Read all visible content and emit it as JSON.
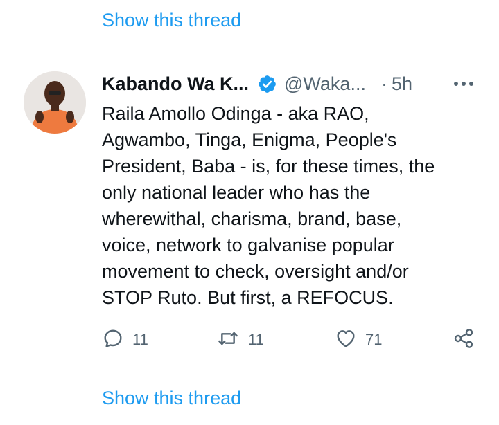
{
  "top_link": {
    "label": "Show this thread"
  },
  "tweet": {
    "author_name": "Kabando Wa K...",
    "handle": "@Waka...",
    "separator": "·",
    "time": "5h",
    "body_lines": [
      "Raila Amollo Odinga - aka RAO,",
      "Agwambo, Tinga, Enigma, People's",
      "President, Baba - is, for these times, the",
      "only national leader who has the",
      "wherewithal, charisma, brand, base,",
      "voice, network to galvanise popular",
      "movement to check, oversight and/or",
      "STOP Ruto. But first, a REFOCUS."
    ],
    "actions": {
      "reply": {
        "icon": "reply-icon",
        "count": "11"
      },
      "repost": {
        "icon": "repost-icon",
        "count": "11"
      },
      "like": {
        "icon": "heart-icon",
        "count": "71"
      },
      "share": {
        "icon": "share-icon"
      }
    }
  },
  "bottom_link": {
    "label": "Show this thread"
  },
  "colors": {
    "link": "#1d9bf0",
    "text": "#0f1419",
    "secondary": "#536471",
    "verified": "#1d9bf0",
    "divider": "#eff3f4"
  }
}
